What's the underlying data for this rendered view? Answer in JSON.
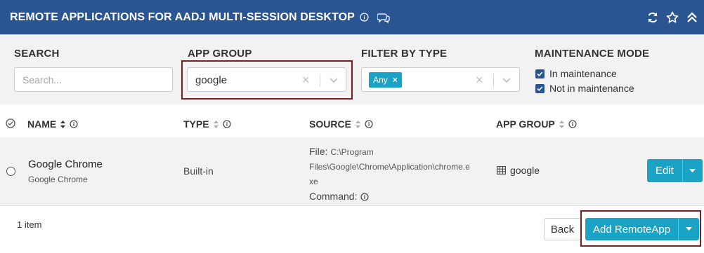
{
  "header": {
    "title": "REMOTE APPLICATIONS FOR AADJ MULTI-SESSION DESKTOP",
    "icons": [
      "info-icon",
      "chat-icon",
      "refresh-icon",
      "star-icon",
      "collapse-icon"
    ]
  },
  "filters": {
    "search": {
      "label": "SEARCH",
      "placeholder": "Search..."
    },
    "app_group": {
      "label": "APP GROUP",
      "value": "google"
    },
    "filter_by_type": {
      "label": "FILTER BY TYPE",
      "chip": "Any"
    },
    "maintenance_mode": {
      "label": "MAINTENANCE MODE",
      "options": [
        {
          "label": "In maintenance",
          "checked": true
        },
        {
          "label": "Not in maintenance",
          "checked": true
        }
      ]
    }
  },
  "table": {
    "columns": [
      "NAME",
      "TYPE",
      "SOURCE",
      "APP GROUP"
    ],
    "rows": [
      {
        "name": "Google Chrome",
        "subname": "Google Chrome",
        "type": "Built-in",
        "source_file_label": "File:",
        "source_file_line1": "C:\\Program",
        "source_file_line2": "Files\\Google\\Chrome\\Application\\chrome.e",
        "source_file_line3": "xe",
        "source_command_label": "Command:",
        "app_group": "google",
        "action": "Edit"
      }
    ]
  },
  "footer": {
    "count": "1 item",
    "back": "Back",
    "add": "Add RemoteApp"
  },
  "colors": {
    "header_bg": "#2b5592",
    "accent": "#1aa3c4",
    "highlight_border": "#7a1f23"
  }
}
